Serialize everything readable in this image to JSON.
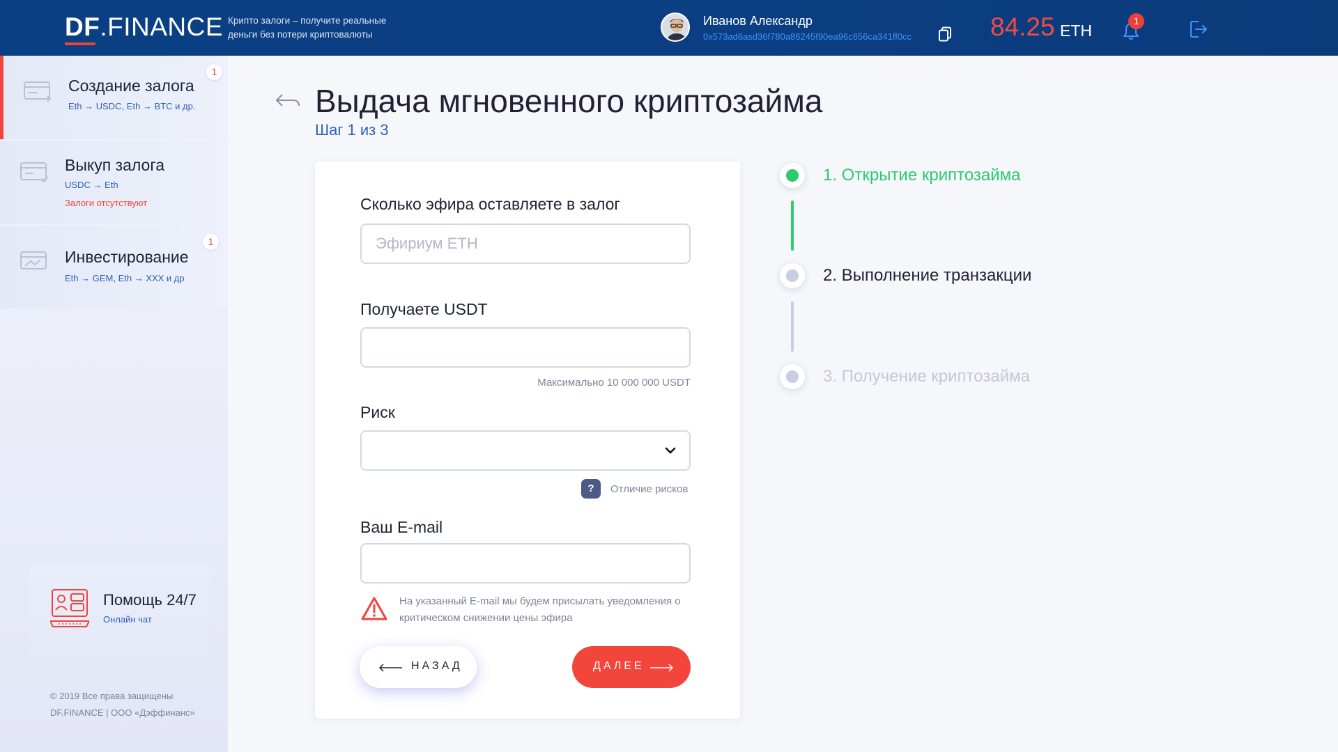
{
  "header": {
    "logo_df": "DF",
    "logo_rest": ".FINANCE",
    "tagline": "Крипто залоги – получите реальные деньги без потери криптовалюты",
    "user_name": "Иванов Александр",
    "wallet_address": "0x573ad6asd36f780a86245f90ea96c656ca341ff0cc",
    "balance_value": "84.25",
    "balance_unit": "ETH",
    "notification_count": "1"
  },
  "sidebar": {
    "items": [
      {
        "title": "Создание залога",
        "subtitle": "Eth → USDC, Eth → BTC и др.",
        "badge": "1"
      },
      {
        "title": "Выкуп залога",
        "subtitle": "USDC → Eth",
        "warning": "Залоги отсутствуют"
      },
      {
        "title": "Инвестирование",
        "subtitle": "Eth → GEM, Eth → XXX и др",
        "badge": "1"
      }
    ],
    "help_title": "Помощь 24/7",
    "help_sub": "Онлайн чат",
    "copyright_line1": "© 2019 Все права защищены",
    "copyright_line2": "DF.FINANCE  | ООО «Дэффинанс»"
  },
  "main": {
    "title": "Выдача мгновенного криптозайма",
    "step_info": "Шаг 1 из 3"
  },
  "form": {
    "eth_label": "Сколько эфира оставляете в залог",
    "eth_placeholder": "Эфириум ETH",
    "eth_value": "",
    "usdt_label": "Получаете USDT",
    "usdt_value": "",
    "usdt_hint": "Максимально 10 000 000 USDT",
    "risk_label": "Риск",
    "risk_value": "",
    "risk_help_icon": "?",
    "risk_help": "Отличие рисков",
    "email_label": "Ваш E-mail",
    "email_value": "",
    "email_warning": "На указанный E-mail мы будем присылать уведомления о критическом снижении цены эфира",
    "back_button": "НАЗАД",
    "next_button": "ДАЛЕЕ"
  },
  "steps": [
    {
      "label": "1. Открытие криптозайма",
      "state": "active"
    },
    {
      "label": "2. Выполнение транзакции",
      "state": "next"
    },
    {
      "label": "3. Получение криптозайма",
      "state": "disabled"
    }
  ],
  "colors": {
    "header_bg": "#0b3f84",
    "accent_red": "#f2463c",
    "link_blue": "#2d5fb8",
    "step_active": "#2ecb6e",
    "step_pending": "#c8cde0",
    "step_disabled_text": "#c5c9d6"
  }
}
